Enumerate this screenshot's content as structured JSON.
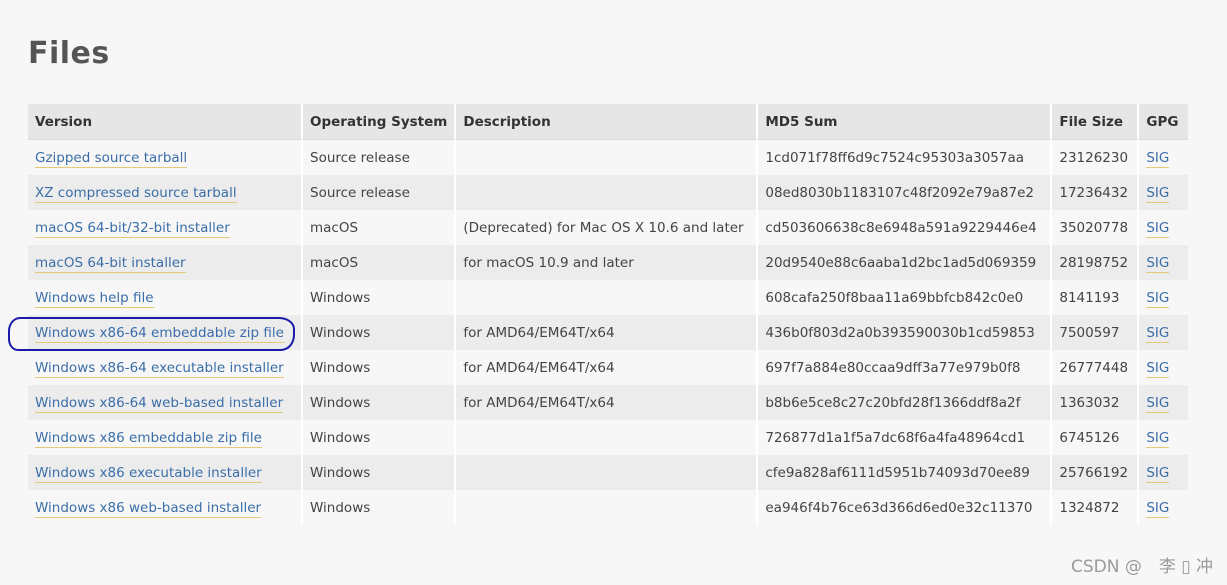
{
  "page": {
    "title": "Files"
  },
  "table": {
    "headers": [
      "Version",
      "Operating System",
      "Description",
      "MD5 Sum",
      "File Size",
      "GPG"
    ],
    "rows": [
      {
        "version": "Gzipped source tarball",
        "os": "Source release",
        "description": "",
        "md5": "1cd071f78ff6d9c7524c95303a3057aa",
        "size": "23126230",
        "gpg": "SIG"
      },
      {
        "version": "XZ compressed source tarball",
        "os": "Source release",
        "description": "",
        "md5": "08ed8030b1183107c48f2092e79a87e2",
        "size": "17236432",
        "gpg": "SIG"
      },
      {
        "version": "macOS 64-bit/32-bit installer",
        "os": "macOS",
        "description": "(Deprecated) for Mac OS X 10.6 and later",
        "md5": "cd503606638c8e6948a591a9229446e4",
        "size": "35020778",
        "gpg": "SIG"
      },
      {
        "version": "macOS 64-bit installer",
        "os": "macOS",
        "description": "for macOS 10.9 and later",
        "md5": "20d9540e88c6aaba1d2bc1ad5d069359",
        "size": "28198752",
        "gpg": "SIG"
      },
      {
        "version": "Windows help file",
        "os": "Windows",
        "description": "",
        "md5": "608cafa250f8baa11a69bbfcb842c0e0",
        "size": "8141193",
        "gpg": "SIG"
      },
      {
        "version": "Windows x86-64 embeddable zip file",
        "os": "Windows",
        "description": "for AMD64/EM64T/x64",
        "md5": "436b0f803d2a0b393590030b1cd59853",
        "size": "7500597",
        "gpg": "SIG"
      },
      {
        "version": "Windows x86-64 executable installer",
        "os": "Windows",
        "description": "for AMD64/EM64T/x64",
        "md5": "697f7a884e80ccaa9dff3a77e979b0f8",
        "size": "26777448",
        "gpg": "SIG"
      },
      {
        "version": "Windows x86-64 web-based installer",
        "os": "Windows",
        "description": "for AMD64/EM64T/x64",
        "md5": "b8b6e5ce8c27c20bfd28f1366ddf8a2f",
        "size": "1363032",
        "gpg": "SIG"
      },
      {
        "version": "Windows x86 embeddable zip file",
        "os": "Windows",
        "description": "",
        "md5": "726877d1a1f5a7dc68f6a4fa48964cd1",
        "size": "6745126",
        "gpg": "SIG"
      },
      {
        "version": "Windows x86 executable installer",
        "os": "Windows",
        "description": "",
        "md5": "cfe9a828af6111d5951b74093d70ee89",
        "size": "25766192",
        "gpg": "SIG"
      },
      {
        "version": "Windows x86 web-based installer",
        "os": "Windows",
        "description": "",
        "md5": "ea946f4b76ce63d366d6ed0e32c11370",
        "size": "1324872",
        "gpg": "SIG"
      }
    ]
  },
  "watermark": "CSDN @　李 ▯ 冲",
  "colors": {
    "link": "#3b6ea8",
    "link_underline": "#e4c97a",
    "annotation": "#1a1aa8"
  }
}
